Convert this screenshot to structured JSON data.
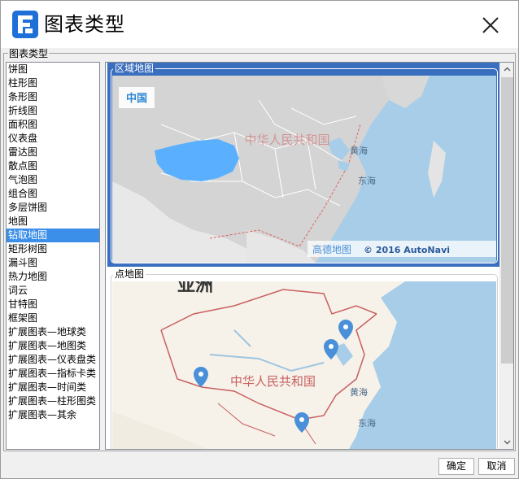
{
  "dialog": {
    "title": "图表类型",
    "colors": {
      "accent": "#3a6fbf",
      "selection": "#3c8fe8",
      "region_highlight": "#5ab0ff",
      "pin": "#4a90d9"
    }
  },
  "group": {
    "label": "图表类型"
  },
  "chart_types": [
    "饼图",
    "柱形图",
    "条形图",
    "折线图",
    "面积图",
    "仪表盘",
    "雷达图",
    "散点图",
    "气泡图",
    "组合图",
    "多层饼图",
    "地图",
    "钻取地图",
    "矩形树图",
    "漏斗图",
    "热力地图",
    "词云",
    "甘特图",
    "框架图",
    "扩展图表—地球类",
    "扩展图表—地图类",
    "扩展图表—仪表盘类",
    "扩展图表—指标卡类",
    "扩展图表—时间类",
    "扩展图表—柱形图类",
    "扩展图表—其余"
  ],
  "selected_index": 12,
  "previews": {
    "region_map": {
      "label": "区域地图",
      "map_labels": {
        "country": "中国",
        "watermark": "中华人民共和国",
        "sea1": "黄海",
        "sea2": "东海",
        "attribution_brand": "高德地图",
        "attribution_copy": "© 2016 AutoNavi"
      }
    },
    "point_map": {
      "label": "点地图",
      "map_labels": {
        "continent": "亚洲",
        "country": "中华人民共和国",
        "sea1": "黄海",
        "sea2": "东海"
      }
    }
  },
  "buttons": {
    "ok": "确定",
    "cancel": "取消"
  }
}
